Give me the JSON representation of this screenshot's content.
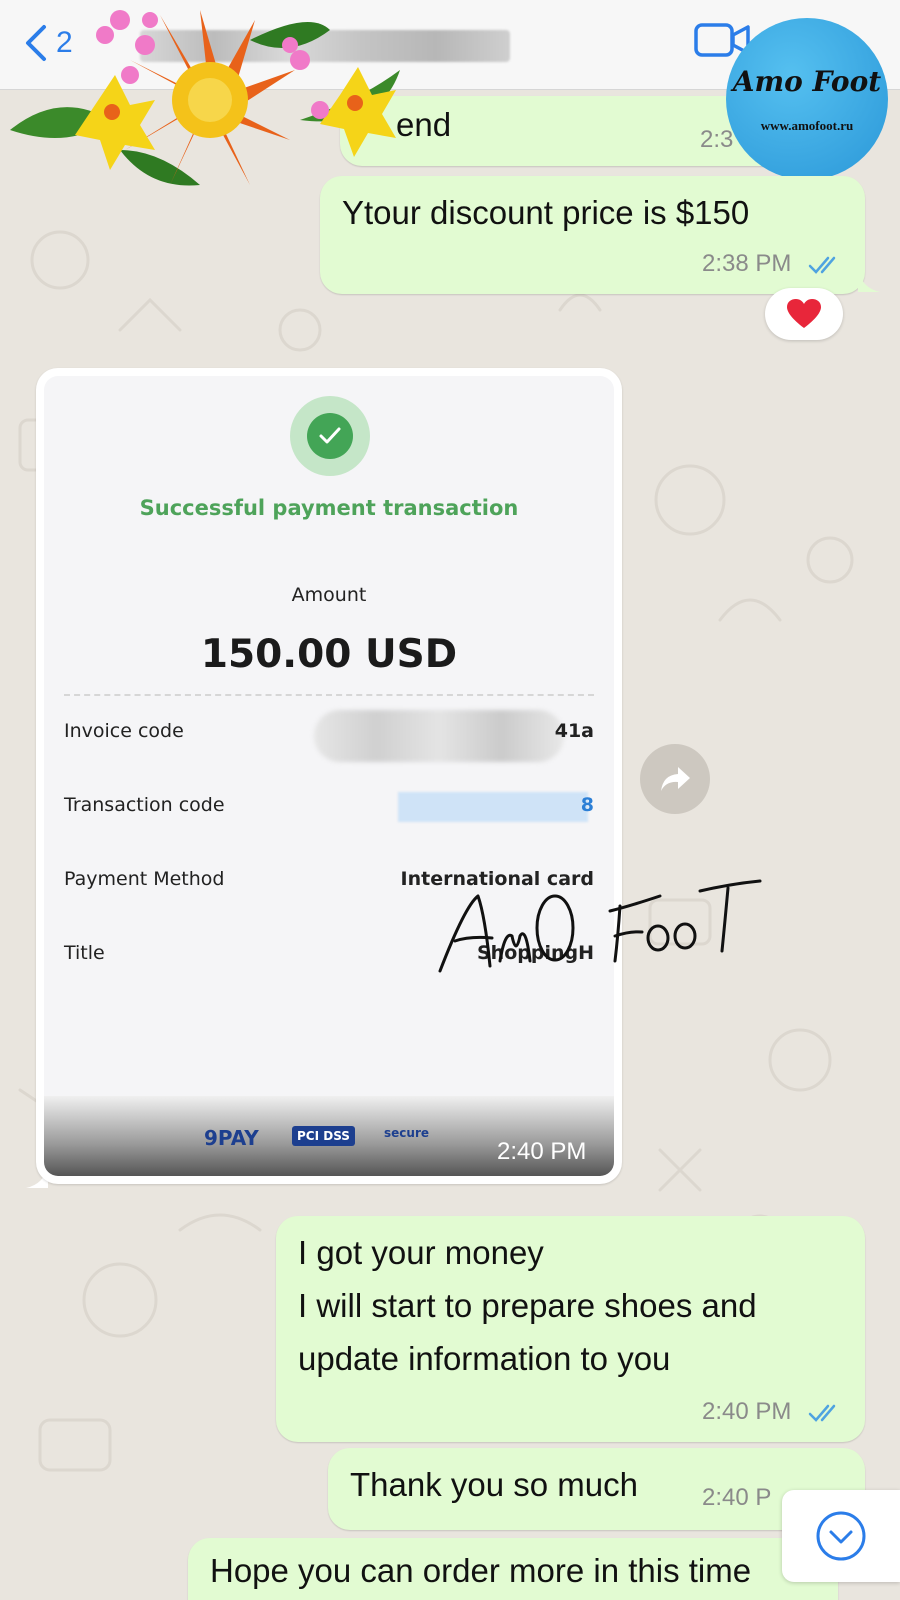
{
  "header": {
    "back_count": "2",
    "accent_color": "#2b7de9"
  },
  "logo": {
    "name": "Amo Foot",
    "url": "www.amofoot.ru"
  },
  "messages": [
    {
      "id": "m0",
      "direction": "outgoing",
      "text": "end",
      "time": "2:3"
    },
    {
      "id": "m1",
      "direction": "outgoing",
      "text": "Ytour discount price is $150",
      "time": "2:38 PM",
      "status": "read"
    },
    {
      "id": "m3",
      "direction": "outgoing",
      "lines": [
        "I got your money",
        "I will start to prepare shoes and",
        "update information to you"
      ],
      "time": "2:40 PM",
      "status": "read"
    },
    {
      "id": "m4",
      "direction": "outgoing",
      "text": "Thank you so much",
      "time": "2:40 P"
    },
    {
      "id": "m5",
      "direction": "outgoing",
      "text": "Hope you can order more in this time"
    }
  ],
  "reaction": {
    "emoji": "❤️"
  },
  "image_message": {
    "time": "2:40 PM",
    "receipt": {
      "status_title": "Successful payment transaction",
      "amount_label": "Amount",
      "amount_value": "150.00 USD",
      "rows": [
        {
          "label": "Invoice code",
          "value": "41a"
        },
        {
          "label": "Transaction code",
          "value": "8"
        },
        {
          "label": "Payment Method",
          "value": "International card"
        },
        {
          "label": "Title",
          "value": "ShoppingH"
        }
      ],
      "footer_logos": [
        "9PAY",
        "PCI DSS",
        "secure"
      ]
    },
    "watermark": "AmO Foot"
  },
  "colors": {
    "bubble_outgoing": "#e2fbd2",
    "chat_background": "#e9e5de",
    "read_ticks": "#4fa3e0",
    "success_green": "#4ea35a"
  }
}
